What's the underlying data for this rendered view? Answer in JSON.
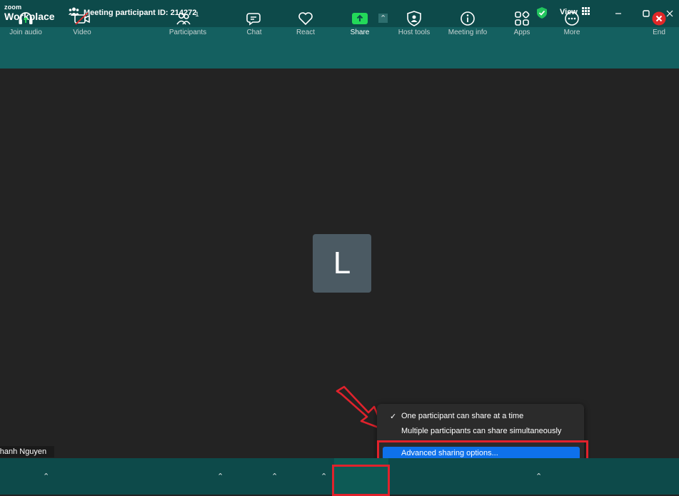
{
  "window": {
    "logo_small": "zoom",
    "logo_big": "Workplace",
    "meeting_label": "Meeting participant ID: 214272",
    "view_label": "View"
  },
  "stage": {
    "avatar_letter": "L",
    "participant_name": "Thanh Nguyen"
  },
  "share_menu": {
    "items": [
      {
        "label": "One participant can share at a time",
        "checked": true
      },
      {
        "label": "Multiple participants can share simultaneously",
        "checked": false
      }
    ],
    "advanced": "Advanced sharing options..."
  },
  "toolbar": {
    "join_audio": "Join audio",
    "video": "Video",
    "participants": "Participants",
    "participants_count": "1",
    "chat": "Chat",
    "react": "React",
    "share": "Share",
    "host_tools": "Host tools",
    "meeting_info": "Meeting info",
    "apps": "Apps",
    "more": "More",
    "end": "End"
  },
  "colors": {
    "titlebar": "#0d4a4a",
    "banner": "#146060",
    "stage": "#232323",
    "share_green": "#23d959",
    "highlight_red": "#e0222c",
    "menu_blue": "#0e71eb",
    "end_red": "#e02828"
  },
  "icons": [
    "participants-icon",
    "shield-check-icon",
    "grid-icon",
    "minimize-icon",
    "maximize-icon",
    "close-icon",
    "headphones-icon",
    "video-off-icon",
    "chat-icon",
    "heart-icon",
    "share-screen-icon",
    "host-shield-icon",
    "info-icon",
    "apps-icon",
    "more-icon",
    "end-icon",
    "check-icon",
    "chevron-up-icon"
  ]
}
